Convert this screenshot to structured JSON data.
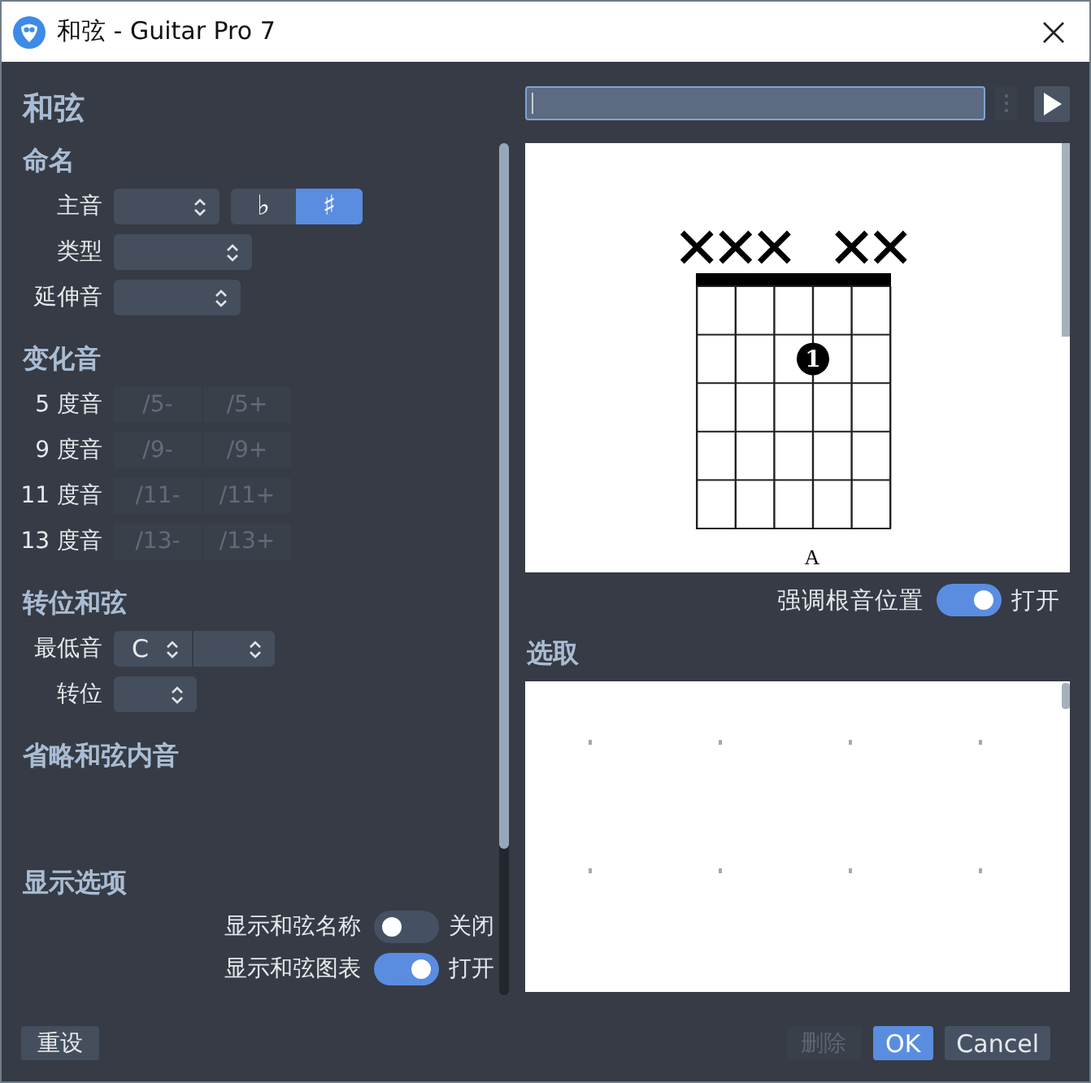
{
  "window": {
    "title": "和弦 - Guitar Pro 7"
  },
  "chord_panel": {
    "title": "和弦",
    "naming": {
      "heading": "命名",
      "rows": [
        {
          "label": "主音",
          "kind": "select_with_accidentals",
          "accidentals": [
            {
              "symbol": "♭",
              "selected": false
            },
            {
              "symbol": "♯",
              "selected": true
            }
          ]
        },
        {
          "label": "类型",
          "kind": "select"
        },
        {
          "label": "延伸音",
          "kind": "select"
        }
      ]
    },
    "alterations": {
      "heading": "变化音",
      "rows": [
        {
          "label": "5 度音",
          "options": [
            {
              "label": "/5-",
              "disabled": true
            },
            {
              "label": "/5+",
              "disabled": true
            }
          ]
        },
        {
          "label": "9 度音",
          "options": [
            {
              "label": "/9-",
              "disabled": true
            },
            {
              "label": "/9+",
              "disabled": true
            }
          ]
        },
        {
          "label": "11 度音",
          "options": [
            {
              "label": "/11-",
              "disabled": true
            },
            {
              "label": "/11+",
              "disabled": true
            }
          ]
        },
        {
          "label": "13 度音",
          "options": [
            {
              "label": "/13-",
              "disabled": true
            },
            {
              "label": "/13+",
              "disabled": true
            }
          ]
        }
      ]
    },
    "inversion": {
      "heading": "转位和弦",
      "rows": [
        {
          "label": "最低音",
          "kind": "double_select",
          "value": "C"
        },
        {
          "label": "转位",
          "kind": "select"
        }
      ]
    },
    "omit_notes": {
      "heading": "省略和弦内音"
    },
    "display_options": {
      "heading": "显示选项",
      "toggles": [
        {
          "label": "显示和弦名称",
          "on": false,
          "state_text": "关闭"
        },
        {
          "label": "显示和弦图表",
          "on": true,
          "state_text": "打开"
        }
      ]
    }
  },
  "diagram_panel": {
    "diagram": {
      "chord_name": "A",
      "strings": [
        {
          "muted": true
        },
        {
          "muted": true
        },
        {
          "muted": true
        },
        {
          "muted": false,
          "frets": [
            {
              "pressed": false
            },
            {
              "pressed": true,
              "finger": "1"
            },
            {
              "pressed": false
            },
            {
              "pressed": false
            },
            {
              "pressed": false
            }
          ]
        },
        {
          "muted": true
        },
        {
          "muted": true
        }
      ]
    },
    "root_highlight": {
      "label": "强调根音位置",
      "on": true,
      "state_text": "打开"
    }
  },
  "selection": {
    "heading": "选取"
  },
  "footer": {
    "reset_button": "重设",
    "buttons": [
      {
        "label": "删除",
        "kind": "secondary",
        "disabled": true
      },
      {
        "label": "OK",
        "kind": "primary",
        "disabled": false
      },
      {
        "label": "Cancel",
        "kind": "secondary",
        "disabled": false
      }
    ]
  }
}
